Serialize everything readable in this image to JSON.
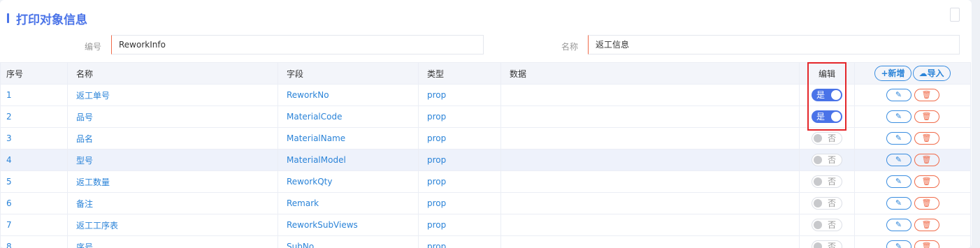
{
  "title": "打印对象信息",
  "fields": {
    "code_label": "编号",
    "code_value": "ReworkInfo",
    "name_label": "名称",
    "name_value": "返工信息"
  },
  "table": {
    "headers": [
      "序号",
      "名称",
      "字段",
      "类型",
      "数据",
      "编辑"
    ],
    "add_label": "+新增",
    "import_label": "导入",
    "rows": [
      {
        "idx": "1",
        "name": "返工单号",
        "field": "ReworkNo",
        "type": "prop",
        "data": "",
        "edit_label": "是",
        "edit_on": true
      },
      {
        "idx": "2",
        "name": "品号",
        "field": "MaterialCode",
        "type": "prop",
        "data": "",
        "edit_label": "是",
        "edit_on": true
      },
      {
        "idx": "3",
        "name": "品名",
        "field": "MaterialName",
        "type": "prop",
        "data": "",
        "edit_label": "否",
        "edit_on": false
      },
      {
        "idx": "4",
        "name": "型号",
        "field": "MaterialModel",
        "type": "prop",
        "data": "",
        "edit_label": "否",
        "edit_on": false
      },
      {
        "idx": "5",
        "name": "返工数量",
        "field": "ReworkQty",
        "type": "prop",
        "data": "",
        "edit_label": "否",
        "edit_on": false
      },
      {
        "idx": "6",
        "name": "备注",
        "field": "Remark",
        "type": "prop",
        "data": "",
        "edit_label": "否",
        "edit_on": false
      },
      {
        "idx": "7",
        "name": "返工工序表",
        "field": "ReworkSubViews",
        "type": "prop",
        "data": "",
        "edit_label": "否",
        "edit_on": false
      },
      {
        "idx": "8",
        "name": "序号",
        "field": "SubNo",
        "type": "prop",
        "data": "",
        "edit_label": "否",
        "edit_on": false
      }
    ]
  },
  "colors": {
    "accent": "#4a73e8",
    "link": "#2a83d8",
    "delete": "#f06b4a",
    "highlight_box": "#e4262a"
  },
  "icons": {
    "add": "plus-icon",
    "import": "cloud-upload-icon",
    "edit": "pencil-icon",
    "delete": "trash-icon"
  }
}
